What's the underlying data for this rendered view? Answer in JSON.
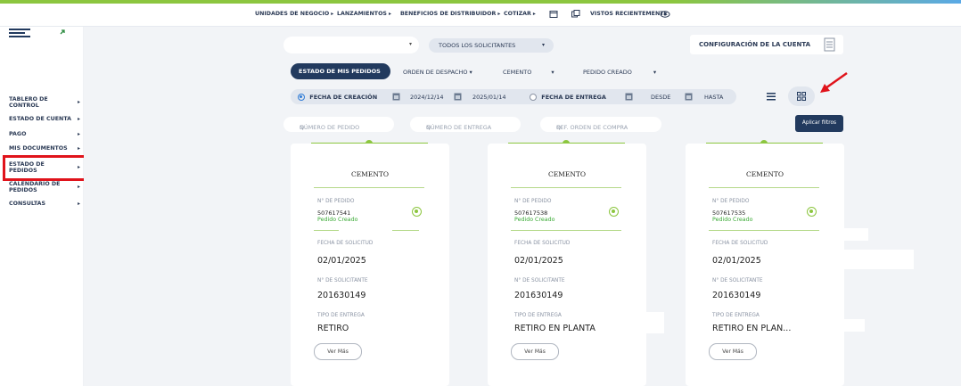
{
  "topnav": {
    "units": "UNIDADES DE NEGOCIO",
    "launches": "LANZAMIENTOS",
    "benefits": "BENEFICIOS DE DISTRIBUIDOR",
    "quote": "COTIZAR",
    "recent": "VISTOS RECIENTEMENTE"
  },
  "sidebar": {
    "items": [
      {
        "label": "TABLERO DE CONTROL"
      },
      {
        "label": "ESTADO DE CUENTA"
      },
      {
        "label": "PAGO"
      },
      {
        "label": "MIS DOCUMENTOS"
      },
      {
        "label": "ESTADO DE PEDIDOS"
      },
      {
        "label": "CALENDARIO DE PEDIDOS"
      },
      {
        "label": "CONSULTAS"
      }
    ]
  },
  "header": {
    "solicitantes": "TODOS LOS SOLICITANTES",
    "config": "CONFIGURACIÓN DE LA CUENTA"
  },
  "filters": {
    "estado": "ESTADO DE MIS PEDIDOS",
    "orden": "ORDEN DE DESPACHO",
    "cemento": "CEMENTO",
    "pedido": "PEDIDO CREADO",
    "fecha_creacion": "FECHA DE CREACIÓN",
    "fecha_from": "2024/12/14",
    "fecha_to": "2025/01/14",
    "fecha_entrega": "FECHA DE ENTREGA",
    "desde": "DESDE",
    "hasta": "HASTA",
    "search_pedido": "NÚMERO DE PEDIDO",
    "search_entrega": "NÚMERO DE ENTREGA",
    "search_oc": "REF. ORDEN DE COMPRA",
    "apply": "Aplicar filtros"
  },
  "card_labels": {
    "pedido": "N° DE PEDIDO",
    "fecha": "FECHA DE SOLICITUD",
    "solicitante": "N° DE SOLICITANTE",
    "tipo": "TIPO DE ENTREGA",
    "button": "Ver Más"
  },
  "cards": [
    {
      "title": "CEMENTO",
      "pedido": "507617541",
      "status": "Pedido Creado",
      "fecha": "02/01/2025",
      "solicitante": "201630149",
      "tipo": "RETIRO"
    },
    {
      "title": "CEMENTO",
      "pedido": "507617538",
      "status": "Pedido Creado",
      "fecha": "02/01/2025",
      "solicitante": "201630149",
      "tipo": "RETIRO EN PLANTA"
    },
    {
      "title": "CEMENTO",
      "pedido": "507617535",
      "status": "Pedido Creado",
      "fecha": "02/01/2025",
      "solicitante": "201630149",
      "tipo": "RETIRO EN PLAN..."
    }
  ],
  "colors": {
    "accent": "#8cc63f",
    "dark": "#223a5e",
    "highlight": "#e0131b"
  }
}
